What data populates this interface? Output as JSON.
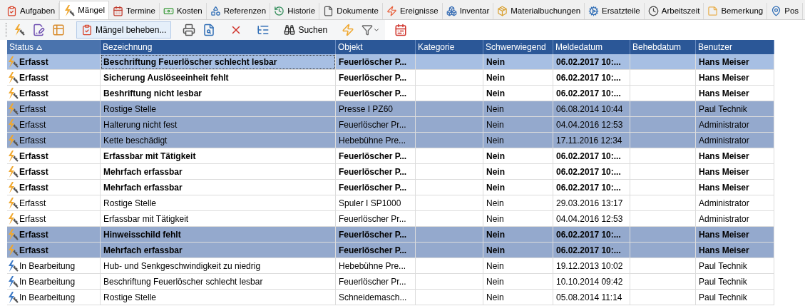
{
  "tabs": [
    {
      "label": "Aufgaben",
      "selected": false
    },
    {
      "label": "Mängel",
      "selected": true
    },
    {
      "label": "Termine",
      "selected": false
    },
    {
      "label": "Kosten",
      "selected": false
    },
    {
      "label": "Referenzen",
      "selected": false
    },
    {
      "label": "Historie",
      "selected": false
    },
    {
      "label": "Dokumente",
      "selected": false
    },
    {
      "label": "Ereignisse",
      "selected": false
    },
    {
      "label": "Inventar",
      "selected": false
    },
    {
      "label": "Materialbuchungen",
      "selected": false
    },
    {
      "label": "Ersatzteile",
      "selected": false
    },
    {
      "label": "Arbeitszeit",
      "selected": false
    },
    {
      "label": "Bemerkung",
      "selected": false
    },
    {
      "label": "Pos",
      "selected": false
    }
  ],
  "toolbar": {
    "fix_button": "Mängel beheben...",
    "search_button": "Suchen"
  },
  "table": {
    "columns": [
      "Status",
      "Bezeichnung",
      "Objekt",
      "Kategorie",
      "Schwerwiegend",
      "Meldedatum",
      "Behebdatum",
      "Benutzer"
    ],
    "rows": [
      {
        "kind": "erfasst",
        "status": "Erfasst",
        "bezeichnung": "Beschriftung Feuerlöscher schlecht lesbar",
        "objekt": "Feuerlöscher P...",
        "schwerwiegend": "Nein",
        "meldedatum": "06.02.2017 10:...",
        "benutzer": "Hans Meiser",
        "bold": true,
        "selected": true,
        "focused": true
      },
      {
        "kind": "erfasst",
        "status": "Erfasst",
        "bezeichnung": "Sicherung Auslöseeinheit fehlt",
        "objekt": "Feuerlöscher P...",
        "schwerwiegend": "Nein",
        "meldedatum": "06.02.2017 10:...",
        "benutzer": "Hans Meiser",
        "bold": true,
        "selected": false,
        "focused": false
      },
      {
        "kind": "erfasst",
        "status": "Erfasst",
        "bezeichnung": "Beshriftung nicht lesbar",
        "objekt": "Feuerlöscher P...",
        "schwerwiegend": "Nein",
        "meldedatum": "06.02.2017 10:...",
        "benutzer": "Hans Meiser",
        "bold": true,
        "selected": false,
        "focused": false
      },
      {
        "kind": "erfasst",
        "status": "Erfasst",
        "bezeichnung": "Rostige Stelle",
        "objekt": "Presse I PZ60",
        "schwerwiegend": "Nein",
        "meldedatum": "06.08.2014 10:44",
        "benutzer": "Paul Technik",
        "bold": false,
        "selected": true,
        "focused": false
      },
      {
        "kind": "erfasst",
        "status": "Erfasst",
        "bezeichnung": "Halterung nicht fest",
        "objekt": "Feuerlöscher Pr...",
        "schwerwiegend": "Nein",
        "meldedatum": "04.04.2016 12:53",
        "benutzer": "Administrator",
        "bold": false,
        "selected": true,
        "focused": false
      },
      {
        "kind": "erfasst",
        "status": "Erfasst",
        "bezeichnung": "Kette beschädigt",
        "objekt": "Hebebühne Pre...",
        "schwerwiegend": "Nein",
        "meldedatum": "17.11.2016 12:34",
        "benutzer": "Administrator",
        "bold": false,
        "selected": true,
        "focused": false
      },
      {
        "kind": "erfasst",
        "status": "Erfasst",
        "bezeichnung": "Erfassbar mit Tätigkeit",
        "objekt": "Feuerlöscher P...",
        "schwerwiegend": "Nein",
        "meldedatum": "06.02.2017 10:...",
        "benutzer": "Hans Meiser",
        "bold": true,
        "selected": false,
        "focused": false
      },
      {
        "kind": "erfasst",
        "status": "Erfasst",
        "bezeichnung": "Mehrfach erfassbar",
        "objekt": "Feuerlöscher P...",
        "schwerwiegend": "Nein",
        "meldedatum": "06.02.2017 10:...",
        "benutzer": "Hans Meiser",
        "bold": true,
        "selected": false,
        "focused": false
      },
      {
        "kind": "erfasst",
        "status": "Erfasst",
        "bezeichnung": "Mehrfach erfassbar",
        "objekt": "Feuerlöscher P...",
        "schwerwiegend": "Nein",
        "meldedatum": "06.02.2017 10:...",
        "benutzer": "Hans Meiser",
        "bold": true,
        "selected": false,
        "focused": false
      },
      {
        "kind": "erfasst",
        "status": "Erfasst",
        "bezeichnung": "Rostige Stelle",
        "objekt": "Spuler I SP1000",
        "schwerwiegend": "Nein",
        "meldedatum": "29.03.2016 13:17",
        "benutzer": "Administrator",
        "bold": false,
        "selected": false,
        "focused": false
      },
      {
        "kind": "erfasst",
        "status": "Erfasst",
        "bezeichnung": "Erfassbar mit Tätigkeit",
        "objekt": "Feuerlöscher Pr...",
        "schwerwiegend": "Nein",
        "meldedatum": "04.04.2016 12:53",
        "benutzer": "Administrator",
        "bold": false,
        "selected": false,
        "focused": false
      },
      {
        "kind": "erfasst",
        "status": "Erfasst",
        "bezeichnung": "Hinweisschild fehlt",
        "objekt": "Feuerlöscher P...",
        "schwerwiegend": "Nein",
        "meldedatum": "06.02.2017 10:...",
        "benutzer": "Hans Meiser",
        "bold": true,
        "selected": true,
        "focused": false
      },
      {
        "kind": "erfasst",
        "status": "Erfasst",
        "bezeichnung": "Mehrfach erfassbar",
        "objekt": "Feuerlöscher P...",
        "schwerwiegend": "Nein",
        "meldedatum": "06.02.2017 10:...",
        "benutzer": "Hans Meiser",
        "bold": true,
        "selected": true,
        "focused": false
      },
      {
        "kind": "in_bearbeitung",
        "status": "In Bearbeitung",
        "bezeichnung": "Hub- und Senkgeschwindigkeit zu niedrig",
        "objekt": "Hebebühne Pre...",
        "schwerwiegend": "Nein",
        "meldedatum": "19.12.2013 10:02",
        "benutzer": "Paul Technik",
        "bold": false,
        "selected": false,
        "focused": false
      },
      {
        "kind": "in_bearbeitung",
        "status": "In Bearbeitung",
        "bezeichnung": "Beschriftung Feuerlöscher schlecht lesbar",
        "objekt": "Feuerlöscher Pr...",
        "schwerwiegend": "Nein",
        "meldedatum": "10.10.2014 09:42",
        "benutzer": "Paul Technik",
        "bold": false,
        "selected": false,
        "focused": false
      },
      {
        "kind": "in_bearbeitung",
        "status": "In Bearbeitung",
        "bezeichnung": "Rostige Stelle",
        "objekt": "Schneidemasch...",
        "schwerwiegend": "Nein",
        "meldedatum": "05.08.2014 11:14",
        "benutzer": "Paul Technik",
        "bold": false,
        "selected": false,
        "focused": false
      }
    ]
  }
}
